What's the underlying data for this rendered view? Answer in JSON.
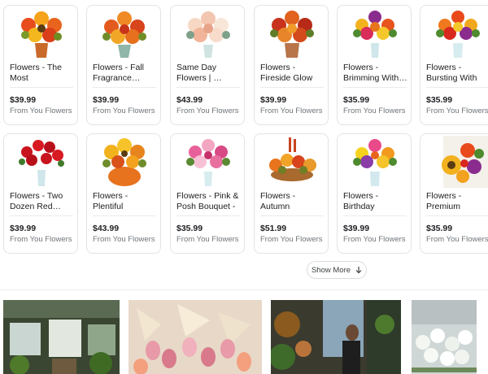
{
  "products": [
    {
      "title": "Flowers - The Most Appealing…",
      "price": "$39.99",
      "seller": "From You Flowers",
      "icon": "flower-bouquet-image"
    },
    {
      "title": "Flowers - Fall Fragrance…",
      "price": "$39.99",
      "seller": "From You Flowers",
      "icon": "flower-bouquet-image"
    },
    {
      "title": "Same Day Flowers | …",
      "price": "$43.99",
      "seller": "From You Flowers",
      "icon": "flower-bouquet-image"
    },
    {
      "title": "Flowers - Fireside Glow Bouquet - …",
      "price": "$39.99",
      "seller": "From You Flowers",
      "icon": "flower-bouquet-image"
    },
    {
      "title": "Flowers - Brimming With…",
      "price": "$35.99",
      "seller": "From You Flowers",
      "icon": "flower-bouquet-image"
    },
    {
      "title": "Flowers - Bursting With Joy Bouqu…",
      "price": "$35.99",
      "seller": "From You Flowers",
      "icon": "flower-bouquet-image"
    },
    {
      "title": "Flowers - Two Dozen Red…",
      "price": "$39.99",
      "seller": "From You Flowers",
      "icon": "flower-bouquet-image"
    },
    {
      "title": "Flowers - Plentiful Pumpkin…",
      "price": "$43.99",
      "seller": "From You Flowers",
      "icon": "flower-bouquet-image"
    },
    {
      "title": "Flowers - Pink & Posh Bouquet - …",
      "price": "$35.99",
      "seller": "From You Flowers",
      "icon": "flower-bouquet-image"
    },
    {
      "title": "Flowers - Autumn Harvest…",
      "price": "$51.99",
      "seller": "From You Flowers",
      "icon": "flower-bouquet-image"
    },
    {
      "title": "Flowers - Birthday Sprinkles…",
      "price": "$39.99",
      "seller": "From You Flowers",
      "icon": "flower-bouquet-image"
    },
    {
      "title": "Flowers - Premium Florist…",
      "price": "$35.99",
      "seller": "From You Flowers",
      "icon": "flower-bouquet-image"
    }
  ],
  "show_more": {
    "label": "Show More",
    "icon": "chevron-down-icon"
  },
  "colors": {
    "price": "#202124",
    "seller": "#70757a",
    "border": "#e3e3e3"
  }
}
